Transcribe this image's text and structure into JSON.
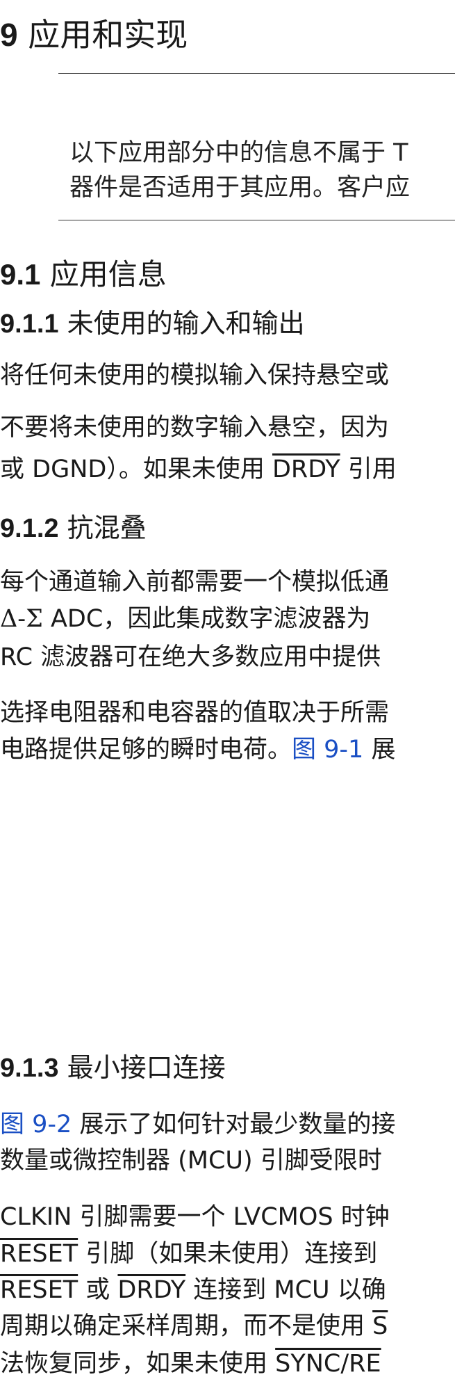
{
  "section": {
    "number": "9",
    "title": "应用和实现"
  },
  "note": {
    "line1": "以下应用部分中的信息不属于 T",
    "line2": "器件是否适用于其应用。客户应"
  },
  "s91": {
    "number": "9.1",
    "title": "应用信息"
  },
  "s911": {
    "number": "9.1.1",
    "title": "未使用的输入和输出",
    "p1": "将任何未使用的模拟输入保持悬空或",
    "p2_l1": "不要将未使用的数字输入悬空，因为",
    "p2_l2_a": "或 DGND）。如果未使用 ",
    "p2_l2_drdy": "DRDY",
    "p2_l2_b": " 引用"
  },
  "s912": {
    "number": "9.1.2",
    "title": "抗混叠",
    "l1": "每个通道输入前都需要一个模拟低通",
    "l2_sigma": "Δ-Σ",
    "l2_rest": " ADC，因此集成数字滤波器为",
    "l3": "RC 滤波器可在绝大多数应用中提供",
    "l4": "选择电阻器和电容器的值取决于所需",
    "l5_a": "电路提供足够的瞬时电荷。",
    "l5_link": "图 9-1",
    "l5_b": " 展"
  },
  "s913": {
    "number": "9.1.3",
    "title": "最小接口连接",
    "l1_link": "图 9-2",
    "l1_rest": " 展示了如何针对最少数量的接",
    "l2": "数量或微控制器 (MCU) 引脚受限时",
    "l3": "CLKIN 引脚需要一个 LVCMOS 时钟",
    "l4_reset": "RESET",
    "l4_rest": " 引脚（如果未使用）连接到",
    "l5_reset": "RESET",
    "l5_mid": " 或 ",
    "l5_drdy": "DRDY",
    "l5_rest": " 连接到 MCU 以确",
    "l6_a": "周期以确定采样周期，而不是使用 ",
    "l6_s": "S",
    "l7_a": "法恢复同步，如果未使用 ",
    "l7_sync": "SYNC/RE"
  }
}
